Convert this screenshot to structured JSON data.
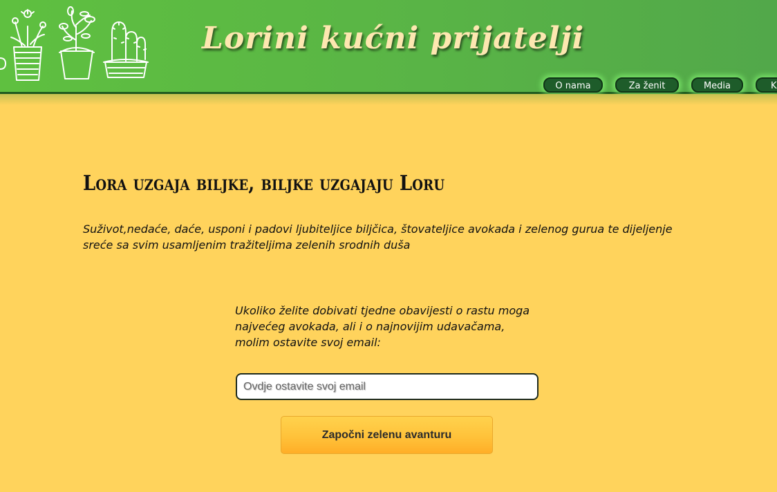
{
  "header": {
    "title": "Lorini kućni prijatelji",
    "nav": [
      {
        "label": "O nama"
      },
      {
        "label": "Za ženit"
      },
      {
        "label": "Media"
      },
      {
        "label": "K"
      }
    ]
  },
  "main": {
    "headline": "Lora uzgaja biljke, biljke uzgajaju Loru",
    "tagline": "Suživot,nedaće, daće, usponi i padovi ljubiteljice biljčica, štovateljice avokada i zelenog gurua te dijeljenje sreće sa svim usamljenim tražiteljima zelenih srodnih duša",
    "signup": {
      "text": "Ukoliko želite dobivati tjedne obavijesti o rastu moga najvećeg avokada, ali i o najnovijim udavačama, molim ostavite svoj email:",
      "email_placeholder": "Ovdje ostavite svoj email",
      "email_value": "",
      "button_label": "Započni zelenu avanturu"
    }
  },
  "colors": {
    "header_green": "#59b446",
    "page_background": "#ffd35c",
    "nav_button": "#1e5c2a",
    "cta_button": "#ffc23a"
  },
  "icons": [
    "potted-plants-illustration"
  ]
}
